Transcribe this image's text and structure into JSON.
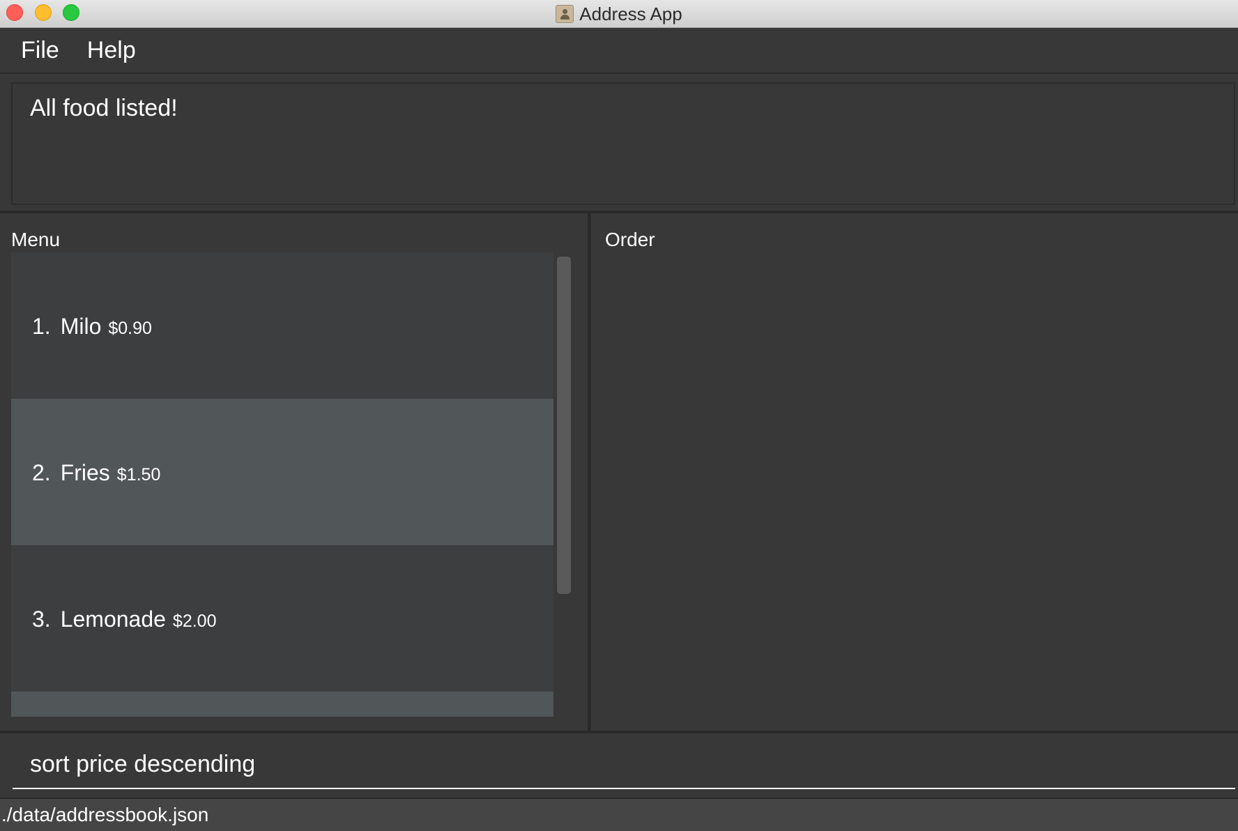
{
  "window": {
    "title": "Address App",
    "icon": "address-book-icon"
  },
  "menubar": {
    "items": [
      {
        "label": "File"
      },
      {
        "label": "Help"
      }
    ]
  },
  "result": {
    "message": "All food listed!"
  },
  "menu_panel": {
    "label": "Menu",
    "items": [
      {
        "index": "1.",
        "name": "Milo",
        "price": "$0.90",
        "selected": false
      },
      {
        "index": "2.",
        "name": "Fries",
        "price": "$1.50",
        "selected": true
      },
      {
        "index": "3.",
        "name": "Lemonade",
        "price": "$2.00",
        "selected": false
      }
    ]
  },
  "order_panel": {
    "label": "Order"
  },
  "command": {
    "value": "sort price descending"
  },
  "status": {
    "file_path": "./data/addressbook.json"
  },
  "colors": {
    "background": "#383838",
    "card_dark": "#3c3e40",
    "card_light": "#515658",
    "text": "#ffffff"
  }
}
